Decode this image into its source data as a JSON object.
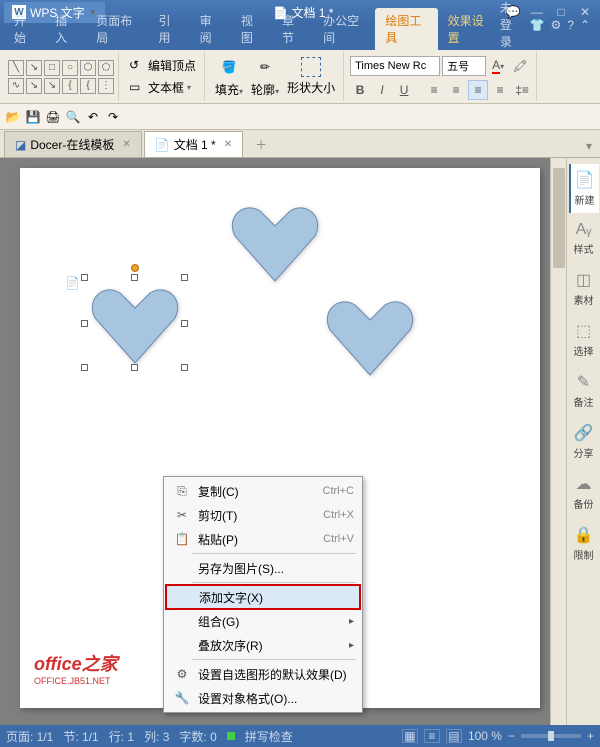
{
  "titlebar": {
    "app_name": "WPS 文字",
    "doc_title": "文档 1 *"
  },
  "menubar": {
    "items": [
      "开始",
      "插入",
      "页面布局",
      "引用",
      "审阅",
      "视图",
      "章节",
      "办公空间",
      "绘图工具",
      "效果设置"
    ],
    "active_index": 8,
    "login_text": "未登录"
  },
  "ribbon": {
    "edit_vertex": "编辑顶点",
    "textbox": "文本框",
    "fill": "填充",
    "outline": "轮廓",
    "shape_size": "形状大小",
    "font_name": "Times New Rc",
    "font_size": "五号"
  },
  "tabs": {
    "items": [
      {
        "label": "Docer-在线模板",
        "active": false
      },
      {
        "label": "文档 1 *",
        "active": true
      }
    ]
  },
  "context_menu": {
    "copy": "复制(C)",
    "copy_sc": "Ctrl+C",
    "cut": "剪切(T)",
    "cut_sc": "Ctrl+X",
    "paste": "粘贴(P)",
    "paste_sc": "Ctrl+V",
    "save_as_pic": "另存为图片(S)...",
    "add_text": "添加文字(X)",
    "group": "组合(G)",
    "order": "叠放次序(R)",
    "set_default": "设置自选图形的默认效果(D)",
    "format_object": "设置对象格式(O)..."
  },
  "sidebar": {
    "new": "新建",
    "style": "样式",
    "material": "素材",
    "select": "选择",
    "note": "备注",
    "share": "分享",
    "backup": "备份",
    "limit": "限制"
  },
  "statusbar": {
    "page": "页面: 1/1",
    "section": "节: 1/1",
    "line": "行: 1",
    "col": "列: 3",
    "words": "字数: 0",
    "spell": "拼写检查",
    "zoom": "100 %"
  },
  "watermark": {
    "main": "office之家",
    "sub": "OFFICE.JB51.NET"
  }
}
